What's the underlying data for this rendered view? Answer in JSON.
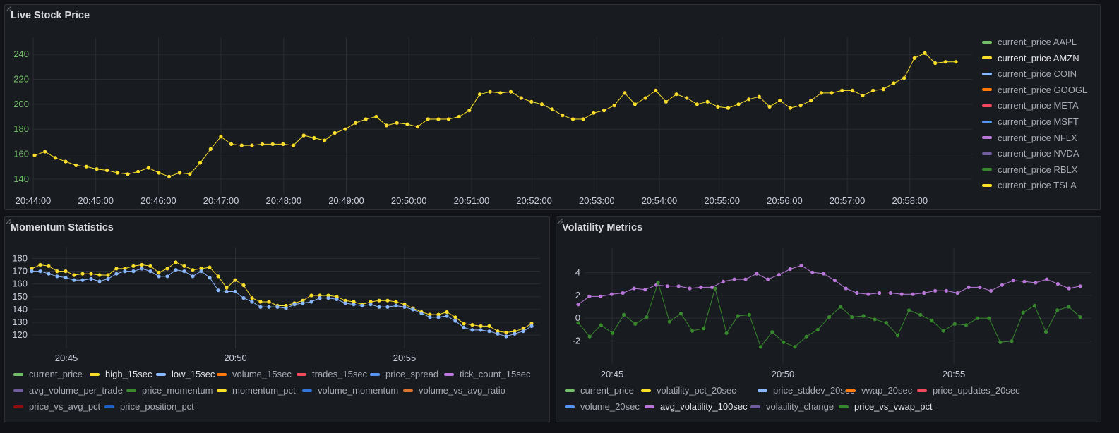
{
  "panels": {
    "live": {
      "title": "Live Stock Price",
      "legend": [
        {
          "label": "current_price AAPL",
          "color": "#73bf69",
          "active": false
        },
        {
          "label": "current_price AMZN",
          "color": "#fade2a",
          "active": true
        },
        {
          "label": "current_price COIN",
          "color": "#8ab8ff",
          "active": false
        },
        {
          "label": "current_price GOOGL",
          "color": "#ff780a",
          "active": false
        },
        {
          "label": "current_price META",
          "color": "#f2495c",
          "active": false
        },
        {
          "label": "current_price MSFT",
          "color": "#5794f2",
          "active": false
        },
        {
          "label": "current_price NFLX",
          "color": "#b877d9",
          "active": false
        },
        {
          "label": "current_price NVDA",
          "color": "#705da0",
          "active": false
        },
        {
          "label": "current_price RBLX",
          "color": "#37872d",
          "active": false
        },
        {
          "label": "current_price TSLA",
          "color": "#fade2a",
          "active": false
        }
      ]
    },
    "momentum": {
      "title": "Momentum Statistics",
      "legend": [
        {
          "label": "current_price",
          "color": "#73bf69",
          "active": false
        },
        {
          "label": "high_15sec",
          "color": "#fade2a",
          "active": true
        },
        {
          "label": "low_15sec",
          "color": "#8ab8ff",
          "active": true
        },
        {
          "label": "volume_15sec",
          "color": "#ff780a",
          "active": false
        },
        {
          "label": "trades_15sec",
          "color": "#f2495c",
          "active": false
        },
        {
          "label": "price_spread",
          "color": "#5794f2",
          "active": false
        },
        {
          "label": "tick_count_15sec",
          "color": "#b877d9",
          "active": false
        },
        {
          "label": "avg_volume_per_trade",
          "color": "#705da0",
          "active": false
        },
        {
          "label": "price_momentum",
          "color": "#37872d",
          "active": false
        },
        {
          "label": "momentum_pct",
          "color": "#fade2a",
          "active": false
        },
        {
          "label": "volume_momentum",
          "color": "#3274d9",
          "active": false
        },
        {
          "label": "volume_vs_avg_ratio",
          "color": "#e0752d",
          "active": false
        },
        {
          "label": "price_vs_avg_pct",
          "color": "#8f0d0d",
          "active": false
        },
        {
          "label": "price_position_pct",
          "color": "#1f60c4",
          "active": false
        }
      ]
    },
    "volatility": {
      "title": "Volatility Metrics",
      "legend": [
        {
          "label": "current_price",
          "color": "#73bf69",
          "active": false
        },
        {
          "label": "volatility_pct_20sec",
          "color": "#fade2a",
          "active": false
        },
        {
          "label": "price_stddev_20sec",
          "color": "#8ab8ff",
          "active": false
        },
        {
          "label": "vwap_20sec",
          "color": "#ff780a",
          "active": false
        },
        {
          "label": "price_updates_20sec",
          "color": "#f2495c",
          "active": false
        },
        {
          "label": "volume_20sec",
          "color": "#5794f2",
          "active": false
        },
        {
          "label": "avg_volatility_100sec",
          "color": "#b877d9",
          "active": true
        },
        {
          "label": "volatility_change",
          "color": "#705da0",
          "active": false
        },
        {
          "label": "price_vs_vwap_pct",
          "color": "#37872d",
          "active": true
        }
      ]
    }
  },
  "chart_data": [
    {
      "type": "line",
      "title": "Live Stock Price",
      "ylim": [
        132,
        248
      ],
      "yticks": [
        140,
        160,
        180,
        200,
        220,
        240
      ],
      "xlim": [
        "20:44:00",
        "20:59:00"
      ],
      "xticks": [
        "20:44:00",
        "20:45:00",
        "20:46:00",
        "20:47:00",
        "20:48:00",
        "20:49:00",
        "20:50:00",
        "20:51:00",
        "20:52:00",
        "20:53:00",
        "20:54:00",
        "20:55:00",
        "20:56:00",
        "20:57:00",
        "20:58:00"
      ],
      "grid": true,
      "legend_position": "right",
      "series": [
        {
          "name": "current_price AMZN",
          "color": "#fade2a",
          "values": [
            159,
            162,
            157,
            154,
            151,
            150,
            148,
            147,
            145,
            144,
            146,
            149,
            145,
            142,
            145,
            144,
            153,
            164,
            174,
            168,
            167,
            167,
            168,
            168,
            168,
            167,
            175,
            173,
            171,
            177,
            180,
            185,
            188,
            190,
            183,
            185,
            184,
            182,
            188,
            188,
            188,
            190,
            195,
            208,
            210,
            209,
            210,
            205,
            202,
            200,
            196,
            191,
            188,
            188,
            193,
            195,
            199,
            209,
            200,
            205,
            211,
            202,
            208,
            205,
            200,
            202,
            198,
            197,
            200,
            204,
            206,
            198,
            203,
            197,
            199,
            203,
            209,
            209,
            211,
            211,
            207,
            211,
            212,
            217,
            221,
            237,
            241,
            233,
            234,
            234
          ]
        }
      ]
    },
    {
      "type": "line",
      "title": "Momentum Statistics",
      "ylim": [
        114,
        183
      ],
      "yticks": [
        120,
        130,
        140,
        150,
        160,
        170,
        180
      ],
      "xlim": [
        "20:44",
        "20:59"
      ],
      "xticks": [
        "20:45",
        "20:50",
        "20:55"
      ],
      "grid": true,
      "legend_position": "bottom",
      "series": [
        {
          "name": "high_15sec",
          "color": "#fade2a",
          "values": [
            172,
            175,
            174,
            170,
            170,
            167,
            168,
            168,
            167,
            167,
            172,
            172,
            174,
            175,
            174,
            169,
            172,
            177,
            174,
            171,
            172,
            173,
            166,
            157,
            163,
            159,
            149,
            146,
            146,
            143,
            143,
            145,
            147,
            151,
            151,
            151,
            150,
            147,
            146,
            144,
            146,
            147,
            147,
            146,
            144,
            141,
            138,
            136,
            136,
            138,
            134,
            129,
            128,
            127,
            127,
            123,
            122,
            123,
            125,
            129
          ]
        },
        {
          "name": "low_15sec",
          "color": "#8ab8ff",
          "values": [
            170,
            170,
            168,
            166,
            165,
            163,
            163,
            164,
            162,
            164,
            168,
            170,
            170,
            172,
            170,
            166,
            166,
            171,
            170,
            166,
            170,
            165,
            155,
            154,
            154,
            149,
            146,
            142,
            142,
            142,
            141,
            144,
            145,
            146,
            149,
            149,
            148,
            145,
            144,
            143,
            144,
            142,
            142,
            143,
            142,
            140,
            137,
            134,
            134,
            135,
            131,
            126,
            124,
            124,
            123,
            121,
            119,
            121,
            123,
            127
          ]
        }
      ]
    },
    {
      "type": "line",
      "title": "Volatility Metrics",
      "ylim": [
        -3.5,
        5.5
      ],
      "yticks": [
        -2,
        0,
        2,
        4
      ],
      "xlim": [
        "20:44",
        "20:59"
      ],
      "xticks": [
        "20:45",
        "20:50",
        "20:55"
      ],
      "grid": true,
      "legend_position": "bottom",
      "series": [
        {
          "name": "avg_volatility_100sec",
          "color": "#b877d9",
          "values": [
            1.2,
            1.9,
            1.9,
            2.1,
            2.2,
            2.6,
            2.5,
            2.9,
            2.8,
            2.8,
            2.6,
            2.7,
            2.7,
            3.2,
            3.4,
            3.4,
            3.9,
            3.4,
            3.8,
            4.3,
            4.6,
            4.0,
            3.9,
            3.3,
            2.6,
            2.2,
            2.1,
            2.2,
            2.2,
            2.1,
            2.1,
            2.2,
            2.4,
            2.4,
            2.2,
            2.7,
            2.7,
            2.4,
            2.9,
            3.3,
            3.2,
            3.1,
            3.4,
            3.0,
            2.6,
            2.8
          ]
        },
        {
          "name": "price_vs_vwap_pct",
          "color": "#37872d",
          "values": [
            -0.4,
            -1.6,
            -0.6,
            -1.3,
            0.3,
            -0.5,
            0.1,
            3.1,
            -0.3,
            0.4,
            -1.1,
            -0.9,
            2.6,
            -1.3,
            0.2,
            0.3,
            -2.5,
            -1.2,
            -2.1,
            -2.5,
            -1.6,
            -1.0,
            0.1,
            1.0,
            0.1,
            0.2,
            -0.1,
            -0.4,
            -1.5,
            0.7,
            0.3,
            -0.2,
            -1.1,
            -0.5,
            -0.6,
            0.0,
            0.0,
            -2.1,
            -2.0,
            0.5,
            1.1,
            -1.2,
            0.7,
            1.0,
            0.1
          ]
        }
      ]
    }
  ]
}
